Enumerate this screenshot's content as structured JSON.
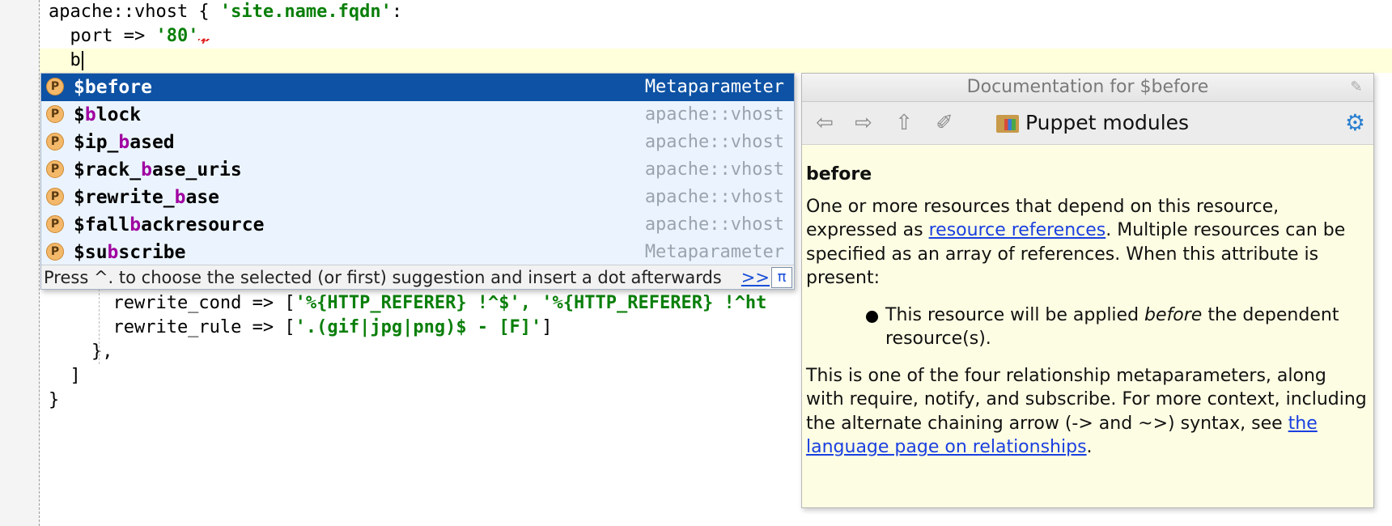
{
  "editor": {
    "lines": [
      {
        "pre": "apache::vhost { ",
        "str": "'site.name.fqdn'",
        "post": ":"
      },
      {
        "pre": "  port => ",
        "str": "'80'",
        "post": ","
      },
      {
        "pre": "  b",
        "str": "",
        "post": ""
      },
      {
        "pre": "      rewrite_cond => [",
        "str": "'%{HTTP_REFERER} !^$', '%{HTTP_REFERER} !^ht",
        "post": ""
      },
      {
        "pre": "      rewrite_rule => [",
        "str": "'.(gif|jpg|png)$ - [F]'",
        "post": "]"
      },
      {
        "pre": "    },",
        "str": "",
        "post": ""
      },
      {
        "pre": "  ]",
        "str": "",
        "post": ""
      },
      {
        "pre": "}",
        "str": "",
        "post": ""
      }
    ]
  },
  "completion": {
    "items": [
      {
        "badge": "P",
        "name_before": "$",
        "match": "b",
        "name_after": "efore",
        "type": "Metaparameter"
      },
      {
        "badge": "P",
        "name_before": "$",
        "match": "b",
        "name_after": "lock",
        "type": "apache::vhost"
      },
      {
        "badge": "P",
        "name_before": "$ip_",
        "match": "b",
        "name_after": "ased",
        "type": "apache::vhost"
      },
      {
        "badge": "P",
        "name_before": "$rack_",
        "match": "b",
        "name_after": "ase_uris",
        "type": "apache::vhost"
      },
      {
        "badge": "P",
        "name_before": "$rewrite_",
        "match": "b",
        "name_after": "ase",
        "type": "apache::vhost"
      },
      {
        "badge": "P",
        "name_before": "$fall",
        "match": "b",
        "name_after": "ackresource",
        "type": "apache::vhost"
      },
      {
        "badge": "P",
        "name_before": "$su",
        "match": "b",
        "name_after": "scribe",
        "type": "Metaparameter"
      }
    ],
    "hint": "Press ^. to choose the selected (or first) suggestion and insert a dot afterwards",
    "more": ">>",
    "pi": "π"
  },
  "doc": {
    "title": "Documentation for $before",
    "modules_label": "Puppet modules",
    "heading": "before",
    "p1_a": "One or more resources that depend on this resource, expressed as ",
    "p1_link": "resource references",
    "p1_b": ". Multiple resources can be specified as an array of references. When this attribute is present:",
    "li_a": "This resource will be applied ",
    "li_em": "before",
    "li_b": " the dependent resource(s).",
    "p2_a": "This is one of the four relationship metaparameters, along with require, notify, and subscribe. For more context, including the alternate chaining arrow (-> and ~>) syntax, see ",
    "p2_link": "the language page on relationships",
    "p2_b": "."
  }
}
